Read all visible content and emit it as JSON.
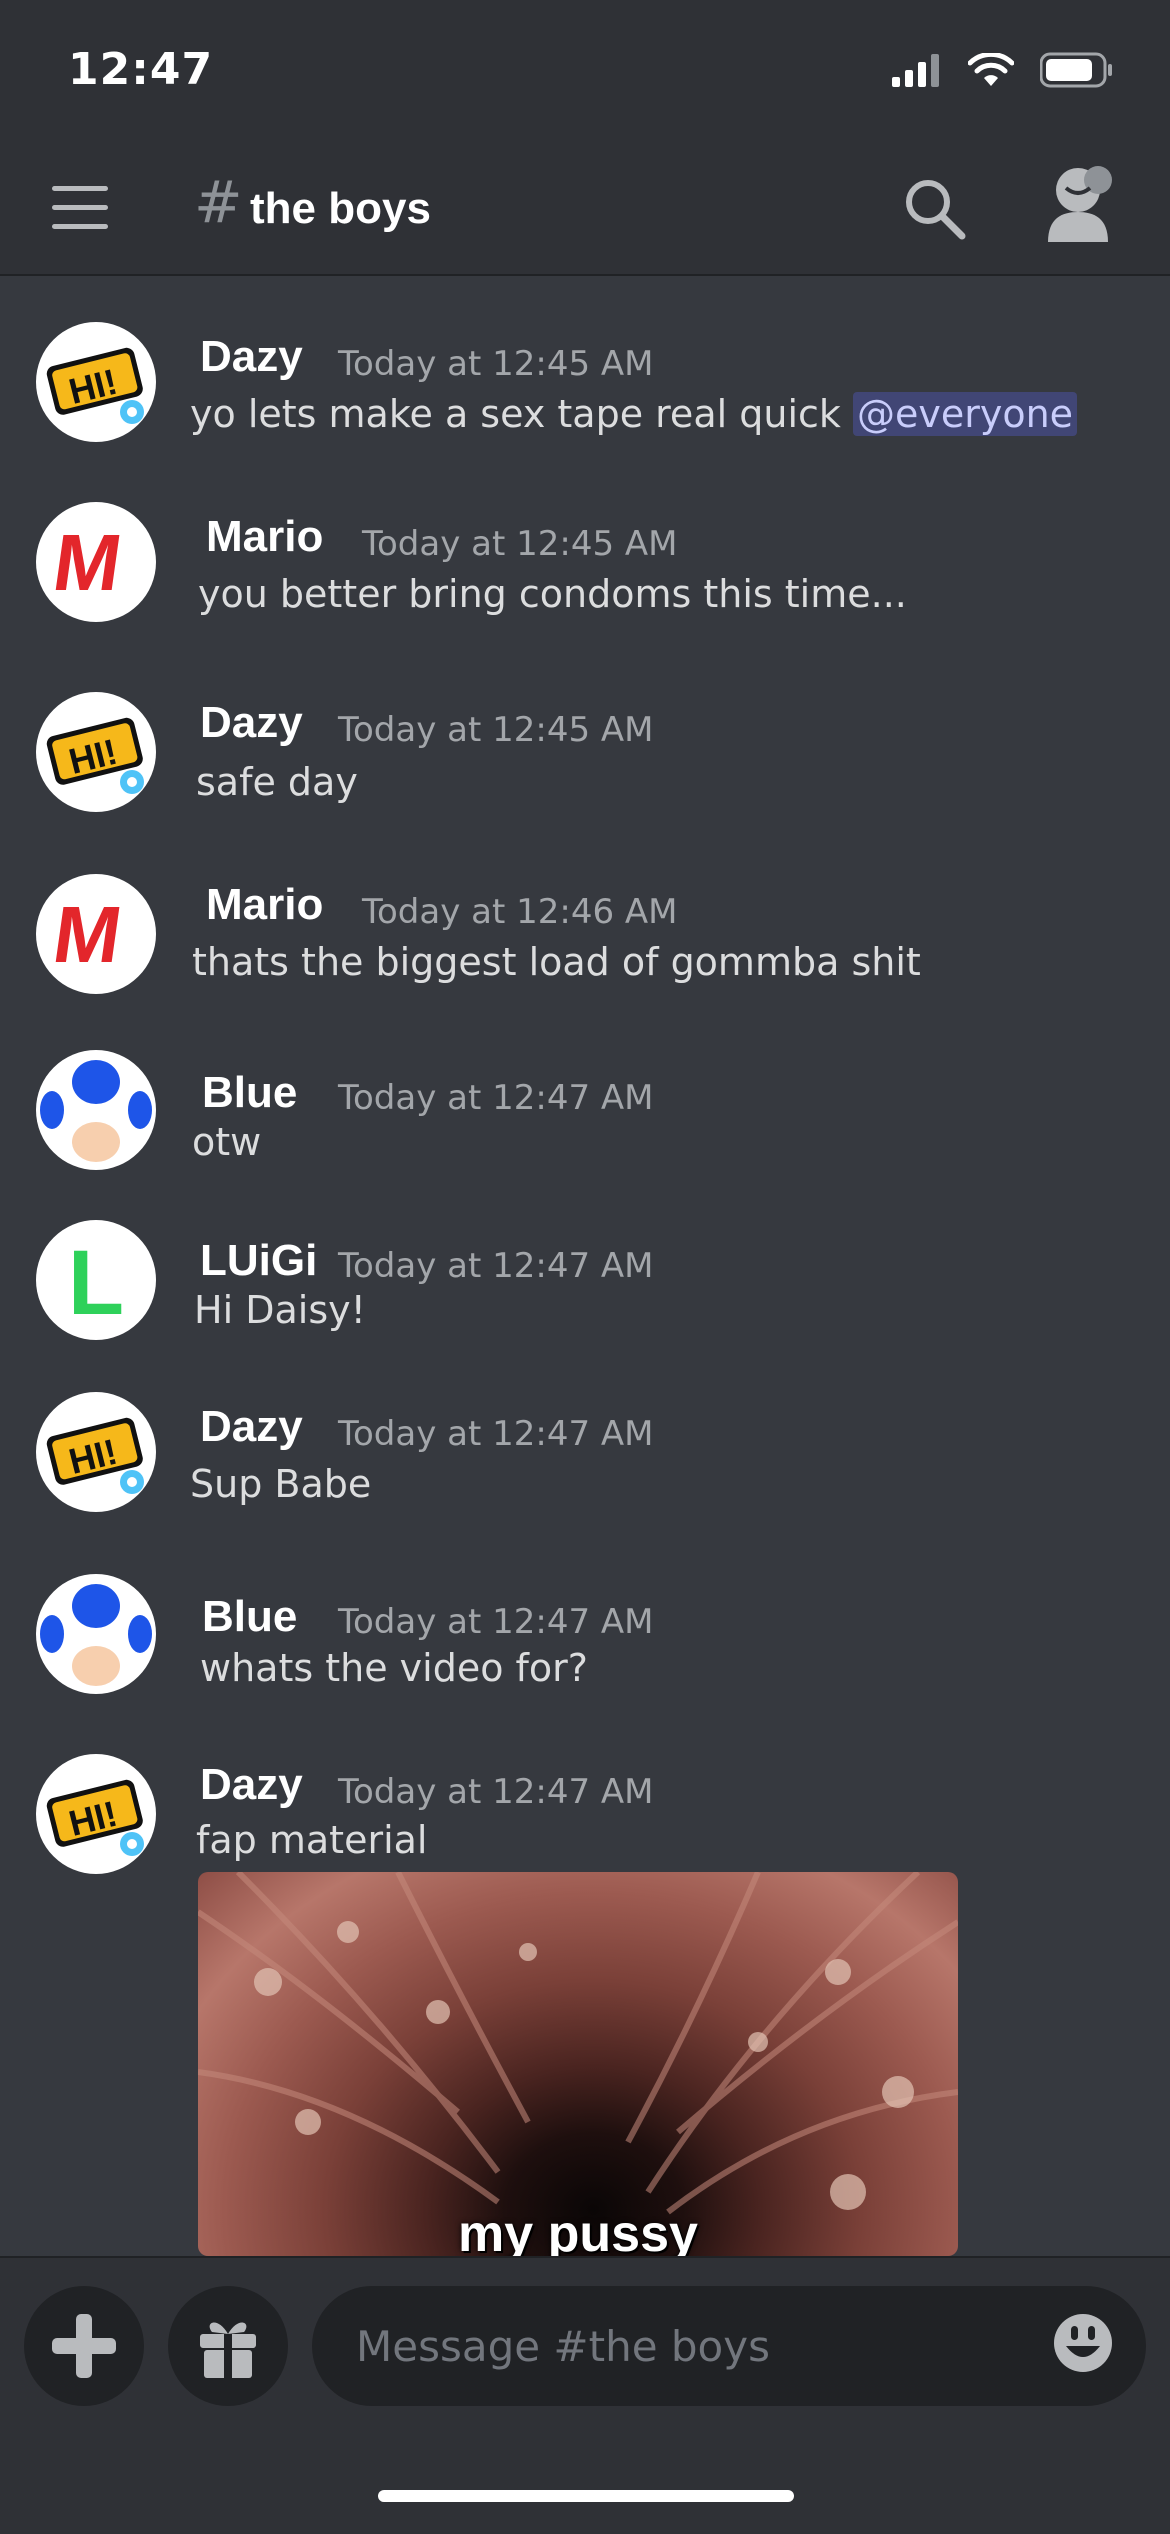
{
  "status_bar": {
    "time": "12:47"
  },
  "header": {
    "hash": "#",
    "channel_name": "the boys"
  },
  "messages": [
    {
      "author": "Dazy",
      "timestamp": "Today at 12:45 AM",
      "text": "yo lets make a sex tape real quick ",
      "mention": "@everyone"
    },
    {
      "author": "Mario",
      "timestamp": "Today at 12:45 AM",
      "text": "you better bring condoms this time..."
    },
    {
      "author": "Dazy",
      "timestamp": "Today at 12:45 AM",
      "text": "safe day"
    },
    {
      "author": "Mario",
      "timestamp": "Today at 12:46 AM",
      "text": "thats the biggest load of gommba shit"
    },
    {
      "author": "Blue",
      "timestamp": "Today at 12:47 AM",
      "text": "otw"
    },
    {
      "author": "LUiGi",
      "timestamp": "Today at 12:47 AM",
      "text": "Hi Daisy!"
    },
    {
      "author": "Dazy",
      "timestamp": "Today at 12:47 AM",
      "text": "Sup Babe"
    },
    {
      "author": "Blue",
      "timestamp": "Today at 12:47 AM",
      "text": "whats the video for?"
    },
    {
      "author": "Dazy",
      "timestamp": "Today at 12:47 AM",
      "text": "fap material"
    }
  ],
  "avatars": {
    "dazy": "HI!",
    "mario": "M",
    "luigi": "L"
  },
  "attachment": {
    "caption": "my pussy"
  },
  "composer": {
    "placeholder": "Message #the boys"
  },
  "colors": {
    "background": "#36393f",
    "header": "#2f3136",
    "mention_bg": "#414675",
    "mention_text": "#c9cdfb"
  }
}
